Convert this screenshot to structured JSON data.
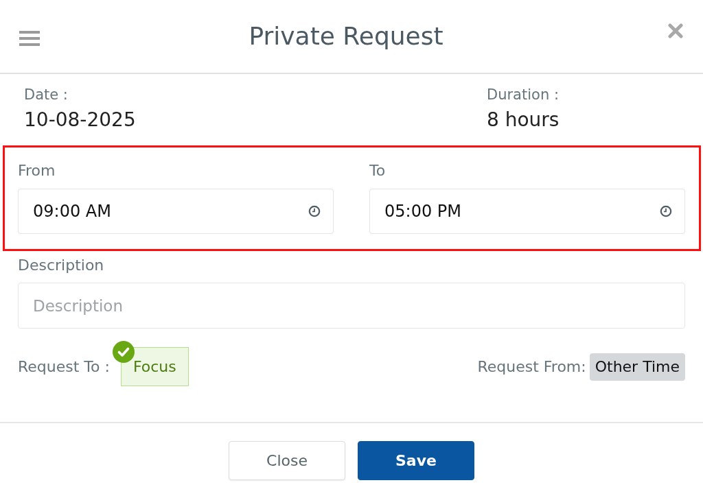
{
  "header": {
    "title": "Private Request"
  },
  "info": [
    {
      "label": "Date :",
      "value": "10-08-2025"
    },
    {
      "label": "Duration :",
      "value": "8 hours"
    }
  ],
  "time_section": {
    "highlighted": true,
    "fields": [
      {
        "label": "From",
        "value": "09:00 AM"
      },
      {
        "label": "To",
        "value": "05:00 PM"
      }
    ]
  },
  "description": {
    "label": "Description",
    "placeholder": "Description"
  },
  "request_to": {
    "label": "Request To :",
    "options": [
      {
        "label": "Focus",
        "selected": true
      }
    ]
  },
  "request_from": {
    "label": "Request From:",
    "value": "Other Time"
  },
  "buttons": [
    {
      "label": "Close",
      "kind": "secondary"
    },
    {
      "label": "Save",
      "kind": "primary"
    }
  ]
}
